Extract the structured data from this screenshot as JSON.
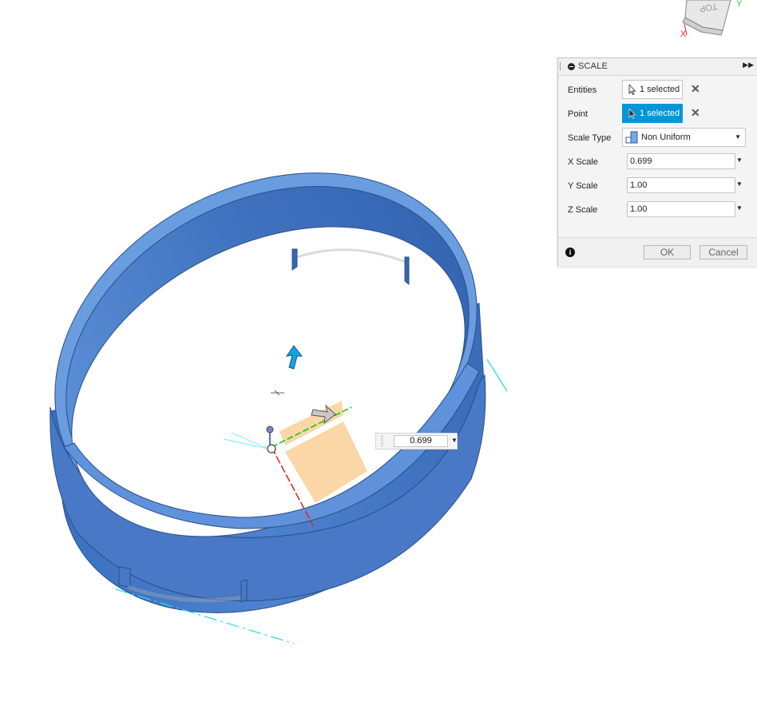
{
  "viewcube": {
    "face_label": "TOP"
  },
  "dialog": {
    "title": "SCALE",
    "entities": {
      "label": "Entities",
      "value": "1 selected"
    },
    "point": {
      "label": "Point",
      "value": "1 selected"
    },
    "scale_type": {
      "label": "Scale Type",
      "value": "Non Uniform"
    },
    "x_scale": {
      "label": "X Scale",
      "value": "0.699"
    },
    "y_scale": {
      "label": "Y Scale",
      "value": "1.00"
    },
    "z_scale": {
      "label": "Z Scale",
      "value": "1.00"
    },
    "info_glyph": "i",
    "ok_label": "OK",
    "cancel_label": "Cancel"
  },
  "canvas_input": {
    "value": "0.699"
  },
  "colors": {
    "model_blue": "#4a7fcb",
    "model_blue_dark": "#2e5fa6",
    "accent": "#0696d7",
    "manipulator_orange": "#f9c98a",
    "axis_green": "#00c800",
    "axis_red": "#e02020",
    "sketch_cyan": "#1fe0e0"
  }
}
